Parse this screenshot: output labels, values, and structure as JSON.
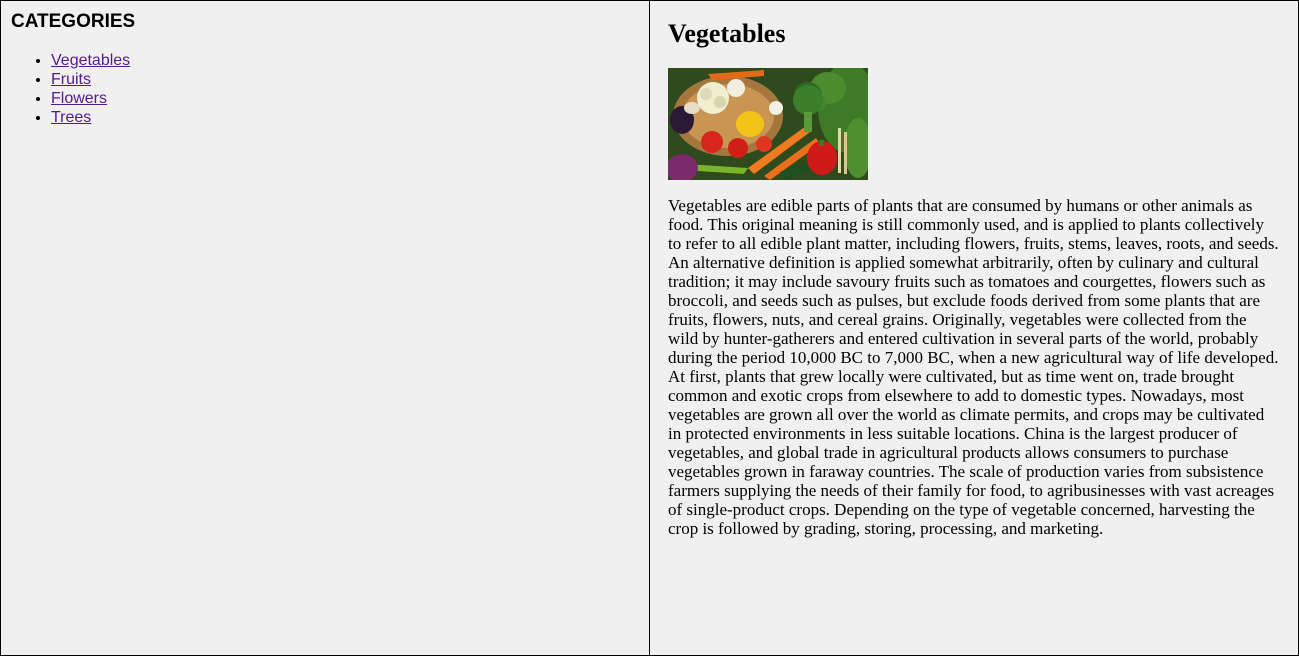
{
  "sidebar": {
    "title": "CATEGORIES",
    "items": [
      {
        "label": "Vegetables"
      },
      {
        "label": "Fruits"
      },
      {
        "label": "Flowers"
      },
      {
        "label": "Trees"
      }
    ]
  },
  "article": {
    "title": "Vegetables",
    "image_icon": "vegetables-photo",
    "body": "Vegetables are edible parts of plants that are consumed by humans or other animals as food. This original meaning is still commonly used, and is applied to plants collectively to refer to all edible plant matter, including flowers, fruits, stems, leaves, roots, and seeds. An alternative definition is applied somewhat arbitrarily, often by culinary and cultural tradition; it may include savoury fruits such as tomatoes and courgettes, flowers such as broccoli, and seeds such as pulses, but exclude foods derived from some plants that are fruits, flowers, nuts, and cereal grains. Originally, vegetables were collected from the wild by hunter-gatherers and entered cultivation in several parts of the world, probably during the period 10,000 BC to 7,000 BC, when a new agricultural way of life developed. At first, plants that grew locally were cultivated, but as time went on, trade brought common and exotic crops from elsewhere to add to domestic types. Nowadays, most vegetables are grown all over the world as climate permits, and crops may be cultivated in protected environments in less suitable locations. China is the largest producer of vegetables, and global trade in agricultural products allows consumers to purchase vegetables grown in faraway countries. The scale of production varies from subsistence farmers supplying the needs of their family for food, to agribusinesses with vast acreages of single-product crops. Depending on the type of vegetable concerned, harvesting the crop is followed by grading, storing, processing, and marketing."
  },
  "colors": {
    "background": "#f0f0f0",
    "visited_link": "#551a8b",
    "border": "#000000"
  }
}
